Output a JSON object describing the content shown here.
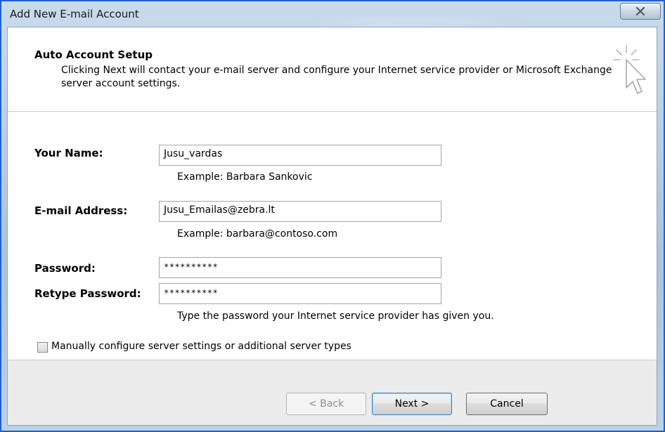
{
  "window": {
    "title": "Add New E-mail Account",
    "close_glyph": "X"
  },
  "header": {
    "heading": "Auto Account Setup",
    "description": "Clicking Next will contact your e-mail server and configure your Internet service provider or Microsoft Exchange server account settings."
  },
  "form": {
    "name": {
      "label": "Your Name:",
      "value": "Jusu_vardas",
      "hint": "Example: Barbara Sankovic"
    },
    "email": {
      "label": "E-mail Address:",
      "value": "Jusu_Emailas@zebra.lt",
      "hint": "Example: barbara@contoso.com"
    },
    "password": {
      "label": "Password:",
      "value": "**********"
    },
    "retype": {
      "label": "Retype Password:",
      "value": "**********"
    },
    "password_hint": "Type the password your Internet service provider has given you.",
    "manual": {
      "label": "Manually configure server settings or additional server types",
      "checked": false
    }
  },
  "buttons": {
    "back": "< Back",
    "next": "Next >",
    "cancel": "Cancel"
  },
  "icons": {
    "close": "close-icon",
    "wizard": "wizard-cursor-icon",
    "checkbox": "checkbox-unchecked"
  },
  "colors": {
    "window_border": "#1f5fd6",
    "default_button_border": "#3c7fb1"
  }
}
